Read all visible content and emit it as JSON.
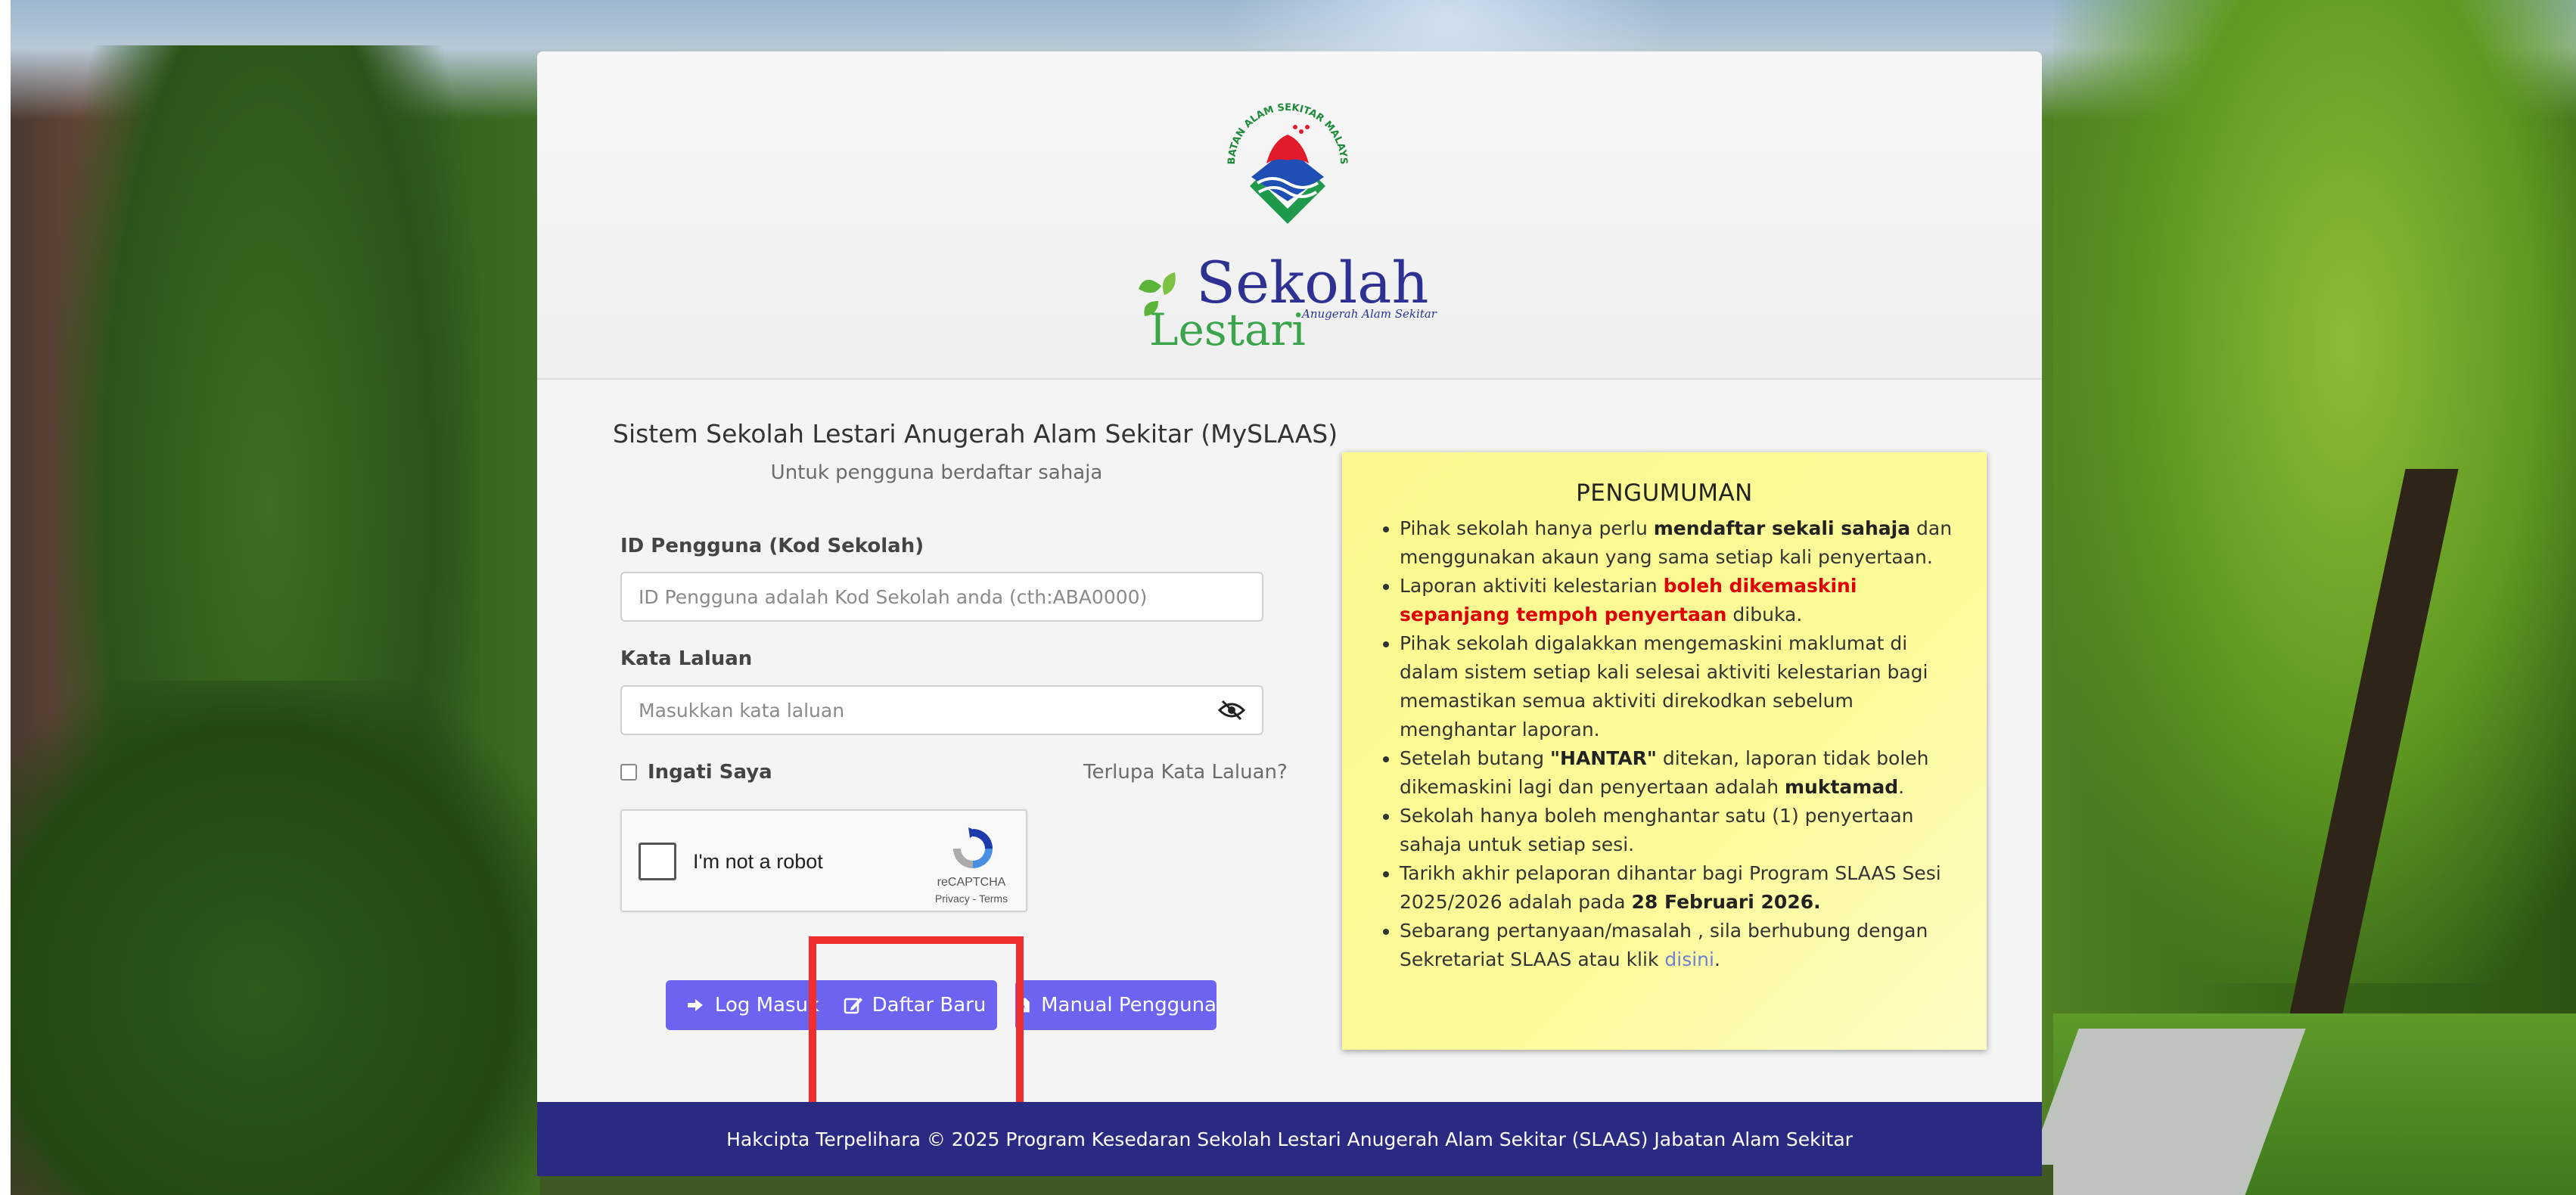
{
  "header": {
    "logo_jas_text": "JABATAN ALAM SEKITAR MALAYSIA",
    "logo_sekolah_word1": "Sekolah",
    "logo_sekolah_word2": "Lestari",
    "logo_tagline": "Anugerah Alam Sekitar"
  },
  "login": {
    "title": "Sistem Sekolah Lestari Anugerah Alam Sekitar (MySLAAS)",
    "subtitle": "Untuk pengguna berdaftar sahaja",
    "user_id_label": "ID Pengguna (Kod Sekolah)",
    "user_id_placeholder": "ID Pengguna adalah Kod Sekolah anda (cth:ABA0000)",
    "user_id_value": "",
    "password_label": "Kata Laluan",
    "password_placeholder": "Masukkan kata laluan",
    "password_value": "",
    "remember_label": "Ingati Saya",
    "forgot_label": "Terlupa Kata Laluan?",
    "recaptcha_label": "I'm not a robot",
    "recaptcha_brand": "reCAPTCHA",
    "recaptcha_links": "Privacy - Terms",
    "buttons": {
      "login": "Log Masuk",
      "register": "Daftar Baru",
      "manual": "Manual Pengguna"
    }
  },
  "announcement": {
    "title": "PENGUMUMAN",
    "items": [
      {
        "a": "Pihak sekolah hanya perlu ",
        "b": "mendaftar sekali sahaja",
        "c": " dan menggunakan akaun yang sama setiap kali penyertaan."
      },
      {
        "a": "Laporan aktiviti kelestarian ",
        "red": "boleh dikemaskini sepanjang tempoh penyertaan",
        "c": " dibuka."
      },
      {
        "a": "Pihak sekolah digalakkan mengemaskini maklumat di dalam sistem setiap kali selesai aktiviti kelestarian bagi memastikan semua aktiviti direkodkan sebelum menghantar laporan."
      },
      {
        "a": "Setelah butang ",
        "b": "\"HANTAR\"",
        "c": " ditekan, laporan tidak boleh dikemaskini lagi dan penyertaan adalah ",
        "d": "muktamad",
        "e": "."
      },
      {
        "a": "Sekolah hanya boleh menghantar satu (1) penyertaan sahaja untuk setiap sesi."
      },
      {
        "a": "Tarikh akhir pelaporan dihantar bagi Program SLAAS Sesi 2025/2026 adalah pada ",
        "b": "28 Februari 2026."
      },
      {
        "a": "Sebarang pertanyaan/masalah , sila berhubung dengan Sekretariat SLAAS atau klik ",
        "link": "disini",
        "c": "."
      }
    ]
  },
  "footer": {
    "text": "Hakcipta Terpelihara © 2025 Program Kesedaran Sekolah Lestari Anugerah Alam Sekitar (SLAAS) Jabatan Alam Sekitar"
  },
  "colors": {
    "button": "#6c63f0",
    "footer": "#2a2a82",
    "highlight": "#ef2e2e",
    "announcement_bg": "#fbf98d"
  }
}
